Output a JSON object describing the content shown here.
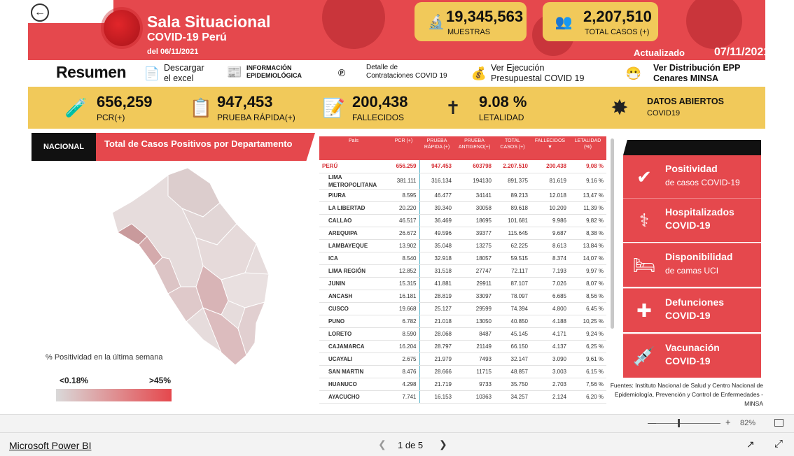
{
  "header": {
    "title": "Sala Situacional",
    "subtitle": "COVID-19 Perú",
    "since": "del 06/11/2021",
    "updated_label": "Actualizado",
    "updated_date": "07/11/2021",
    "muestras_value": "19,345,563",
    "muestras_label": "MUESTRAS",
    "casos_value": "2,207,510",
    "casos_label": "TOTAL CASOS (+)",
    "accent": "#e5484d",
    "yellow": "#f1c95a"
  },
  "links": {
    "resumen": "Resumen",
    "excel_1": "Descargar",
    "excel_2": "el excel",
    "info_1": "INFORMACIÓN",
    "info_2": "EPIDEMIOLÓGICA",
    "compras_1": "Detalle de",
    "compras_2": "Contrataciones COVID 19",
    "presup_1": "Ver Ejecución",
    "presup_2": "Presupuestal COVID 19",
    "epp_1": "Ver Distribución EPP",
    "epp_2": "Cenares MINSA"
  },
  "band": {
    "pcr_value": "656,259",
    "pcr_label": "PCR(+)",
    "rapida_value": "947,453",
    "rapida_label": "PRUEBA RÁPIDA(+)",
    "fallecidos_value": "200,438",
    "fallecidos_label": "FALLECIDOS",
    "letalidad_value": "9.08 %",
    "letalidad_label": "LETALIDAD",
    "abiertos_1": "DATOS ABIERTOS",
    "abiertos_2": "COVID19"
  },
  "map": {
    "tag": "NACIONAL",
    "title": "Total de Casos Positivos por Departamento",
    "legend_caption": "% Positividad en la última semana",
    "legend_min": "<0.18%",
    "legend_max": ">45%"
  },
  "table": {
    "headers": [
      "País",
      "PCR (+)",
      "PRUEBA RÁPIDA (+)",
      "PRUEBA ANTIGENO(+)",
      "TOTAL CASOS (+)",
      "FALLECIDOS",
      "LETALIDAD (%)"
    ],
    "rows": [
      [
        "PERÚ",
        "656.259",
        "947.453",
        "603798",
        "2.207.510",
        "200.438",
        "9,08 %"
      ],
      [
        "LIMA METROPOLITANA",
        "381.111",
        "316.134",
        "194130",
        "891.375",
        "81.619",
        "9,16 %"
      ],
      [
        "PIURA",
        "8.595",
        "46.477",
        "34141",
        "89.213",
        "12.018",
        "13,47 %"
      ],
      [
        "LA LIBERTAD",
        "20.220",
        "39.340",
        "30058",
        "89.618",
        "10.209",
        "11,39 %"
      ],
      [
        "CALLAO",
        "46.517",
        "36.469",
        "18695",
        "101.681",
        "9.986",
        "9,82 %"
      ],
      [
        "AREQUIPA",
        "26.672",
        "49.596",
        "39377",
        "115.645",
        "9.687",
        "8,38 %"
      ],
      [
        "LAMBAYEQUE",
        "13.902",
        "35.048",
        "13275",
        "62.225",
        "8.613",
        "13,84 %"
      ],
      [
        "ICA",
        "8.540",
        "32.918",
        "18057",
        "59.515",
        "8.374",
        "14,07 %"
      ],
      [
        "LIMA REGIÓN",
        "12.852",
        "31.518",
        "27747",
        "72.117",
        "7.193",
        "9,97 %"
      ],
      [
        "JUNIN",
        "15.315",
        "41.881",
        "29911",
        "87.107",
        "7.026",
        "8,07 %"
      ],
      [
        "ANCASH",
        "16.181",
        "28.819",
        "33097",
        "78.097",
        "6.685",
        "8,56 %"
      ],
      [
        "CUSCO",
        "19.668",
        "25.127",
        "29599",
        "74.394",
        "4.800",
        "6,45 %"
      ],
      [
        "PUNO",
        "6.782",
        "21.018",
        "13050",
        "40.850",
        "4.188",
        "10,25 %"
      ],
      [
        "LORETO",
        "8.590",
        "28.068",
        "8487",
        "45.145",
        "4.171",
        "9,24 %"
      ],
      [
        "CAJAMARCA",
        "16.204",
        "28.797",
        "21149",
        "66.150",
        "4.137",
        "6,25 %"
      ],
      [
        "UCAYALI",
        "2.675",
        "21.979",
        "7493",
        "32.147",
        "3.090",
        "9,61 %"
      ],
      [
        "SAN MARTIN",
        "8.476",
        "28.666",
        "11715",
        "48.857",
        "3.003",
        "6,15 %"
      ],
      [
        "HUANUCO",
        "4.298",
        "21.719",
        "9733",
        "35.750",
        "2.703",
        "7,56 %"
      ],
      [
        "AYACUCHO",
        "7.741",
        "16.153",
        "10363",
        "34.257",
        "2.124",
        "6,20 %"
      ]
    ]
  },
  "panel": {
    "items": [
      {
        "title": "Positividad",
        "sub": "de casos COVID-19",
        "icon": "positivity-icon"
      },
      {
        "title": "Hospitalizados",
        "sub": "COVID-19",
        "icon": "stethoscope-icon"
      },
      {
        "title": "Disponibilidad",
        "sub": "de camas UCI",
        "icon": "bed-icon"
      },
      {
        "title": "Defunciones",
        "sub": "COVID-19",
        "icon": "death-icon"
      },
      {
        "title": "Vacunación",
        "sub": "COVID-19",
        "icon": "syringe-icon"
      }
    ],
    "sources": "Fuentes: Instituto Nacional de Salud y Centro Nacional de Epidemiología, Prevención y Control de Enfermedades -MINSA"
  },
  "viewer": {
    "zoom": "82%",
    "app_link": "Microsoft Power BI",
    "page_indicator": "1 de 5"
  }
}
